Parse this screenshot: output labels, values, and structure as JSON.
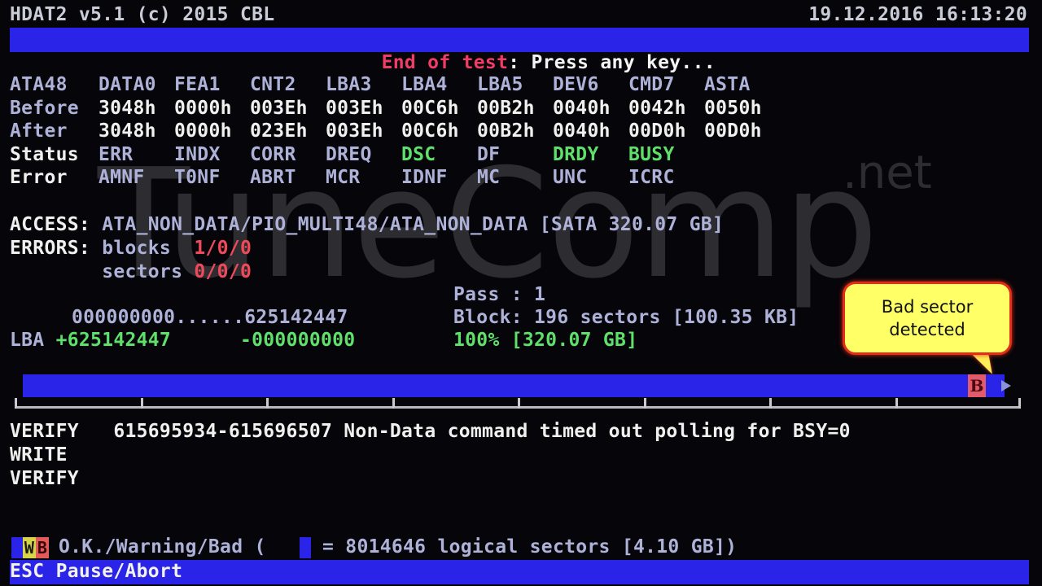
{
  "app": {
    "title": "HDAT2 v5.1 (c) 2015 CBL",
    "datetime": "19.12.2016 16:13:20"
  },
  "status_bar": {
    "state": "End of test",
    "separator": ": ",
    "prompt": "Press any key..."
  },
  "watermark": {
    "main": "TuneComp",
    "suffix": ".net"
  },
  "registers": {
    "header": [
      "ATA48",
      "DATA0",
      "FEA1",
      "CNT2",
      "LBA3",
      "LBA4",
      "LBA5",
      "DEV6",
      "CMD7",
      "ASTA"
    ],
    "before": {
      "label": "Before",
      "values": [
        "3048h",
        "0000h",
        "003Eh",
        "003Eh",
        "00C6h",
        "00B2h",
        "0040h",
        "0042h",
        "0050h"
      ]
    },
    "after": {
      "label": "After",
      "values": [
        "3048h",
        "0000h",
        "023Eh",
        "003Eh",
        "00C6h",
        "00B2h",
        "0040h",
        "00D0h",
        "00D0h"
      ]
    },
    "status": {
      "label": "Status",
      "flags": [
        {
          "name": "ERR",
          "active": false
        },
        {
          "name": "INDX",
          "active": false
        },
        {
          "name": "CORR",
          "active": false
        },
        {
          "name": "DREQ",
          "active": false
        },
        {
          "name": "DSC",
          "active": true
        },
        {
          "name": "DF",
          "active": false
        },
        {
          "name": "DRDY",
          "active": true
        },
        {
          "name": "BUSY",
          "active": true
        }
      ]
    },
    "error": {
      "label": "Error",
      "flags": [
        "AMNF",
        "T0NF",
        "ABRT",
        "MCR",
        "IDNF",
        "MC",
        "UNC",
        "ICRC"
      ]
    }
  },
  "access": {
    "label": "ACCESS:",
    "value": "ATA_NON_DATA/PIO_MULTI48/ATA_NON_DATA [SATA 320.07 GB]"
  },
  "errors": {
    "label": "ERRORS:",
    "blocks_label": "blocks",
    "blocks_value": "1/0/0",
    "sectors_label": "sectors",
    "sectors_value": "0/0/0"
  },
  "scan": {
    "pass": "Pass : 1",
    "block": "Block: 196 sectors [100.35 KB]",
    "percent": "100% [320.07 GB]",
    "range_start": "000000000",
    "range_dots": "......",
    "range_end": "625142447",
    "lba_label": "LBA",
    "lba_plus": "+625142447",
    "lba_minus": "-000000000",
    "progress": 1.0,
    "bad_marker_label": "B",
    "bad_marker_position": 0.972,
    "scale_ticks": 8
  },
  "callout": {
    "line1": "Bad sector",
    "line2": "detected"
  },
  "log": [
    {
      "op": "VERIFY",
      "message": "615695934-615696507 Non-Data command timed out polling for BSY=0"
    },
    {
      "op": "WRITE",
      "message": ""
    },
    {
      "op": "VERIFY",
      "message": ""
    }
  ],
  "legend": {
    "warn_glyph": "W",
    "bad_glyph": "B",
    "text": "O.K./Warning/Bad (",
    "block_text": "= 8014646 logical sectors [4.10 GB])"
  },
  "footer": {
    "key": "ESC",
    "action": "Pause/Abort"
  },
  "colors": {
    "bar_blue": "#2a24e8",
    "ok_green": "#5fe06a",
    "error_red": "#f04a5a",
    "callout_yellow": "#ffff66"
  }
}
